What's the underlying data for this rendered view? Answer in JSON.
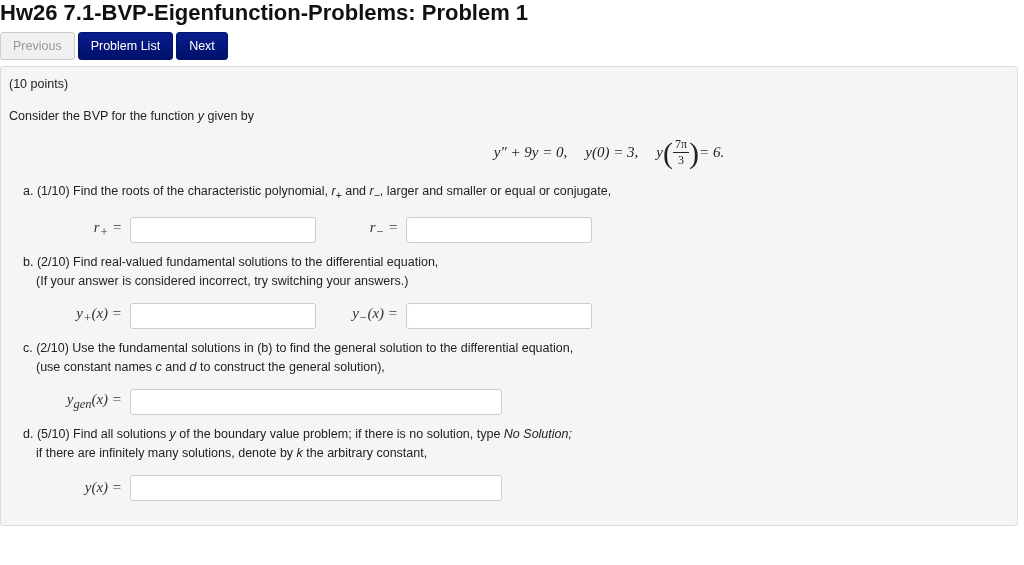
{
  "title": "Hw26 7.1-BVP-Eigenfunction-Problems: Problem 1",
  "nav_buttons": [
    {
      "label": "Previous",
      "disabled": true
    },
    {
      "label": "Problem List",
      "disabled": false
    },
    {
      "label": "Next",
      "disabled": false
    }
  ],
  "problem": {
    "points": "(10 points)",
    "intro": "Consider the BVP for the function *y* given by",
    "equation": [
      {
        "kind": "text",
        "text": "y″ + 9y = 0,"
      },
      {
        "kind": "text",
        "text": "y(0) = 3,"
      },
      {
        "kind": "fraction",
        "prefix": "y",
        "open": "(",
        "close": ")",
        "numerator": "7π",
        "denominator": "3",
        "suffix": "= 6."
      }
    ],
    "parts": [
      {
        "lines": [
          "a. (1/10) Find the roots of the characteristic polynomial, *r*$_{+}$ and *r*$_{−}$, larger and smaller or equal or conjugate,"
        ],
        "fields": [
          {
            "label": "r$_{+}$ ="
          },
          {
            "label": "r$_{−}$ ="
          }
        ]
      },
      {
        "lines": [
          "b. (2/10) Find real-valued fundamental solutions to the differential equation,",
          "(If your answer is considered incorrect, try switching your answers.)"
        ],
        "fields": [
          {
            "label": "y$_{+}$(x) ="
          },
          {
            "label": "y$_{−}$(x) ="
          }
        ]
      },
      {
        "lines": [
          "c. (2/10) Use the fundamental solutions in (b) to find the general solution to the differential equation,",
          "(use constant names *c* and *d* to construct the general solution),"
        ],
        "fields": [
          {
            "label": "y$_{gen}$(x) ="
          }
        ]
      },
      {
        "lines": [
          "d. (5/10) Find all solutions *y* of the boundary value problem; if there is no solution, type *No Solution;*",
          "if there are infinitely many solutions, denote by *k* the arbitrary constant,"
        ],
        "fields": [
          {
            "label": "y(x) ="
          }
        ]
      }
    ]
  }
}
